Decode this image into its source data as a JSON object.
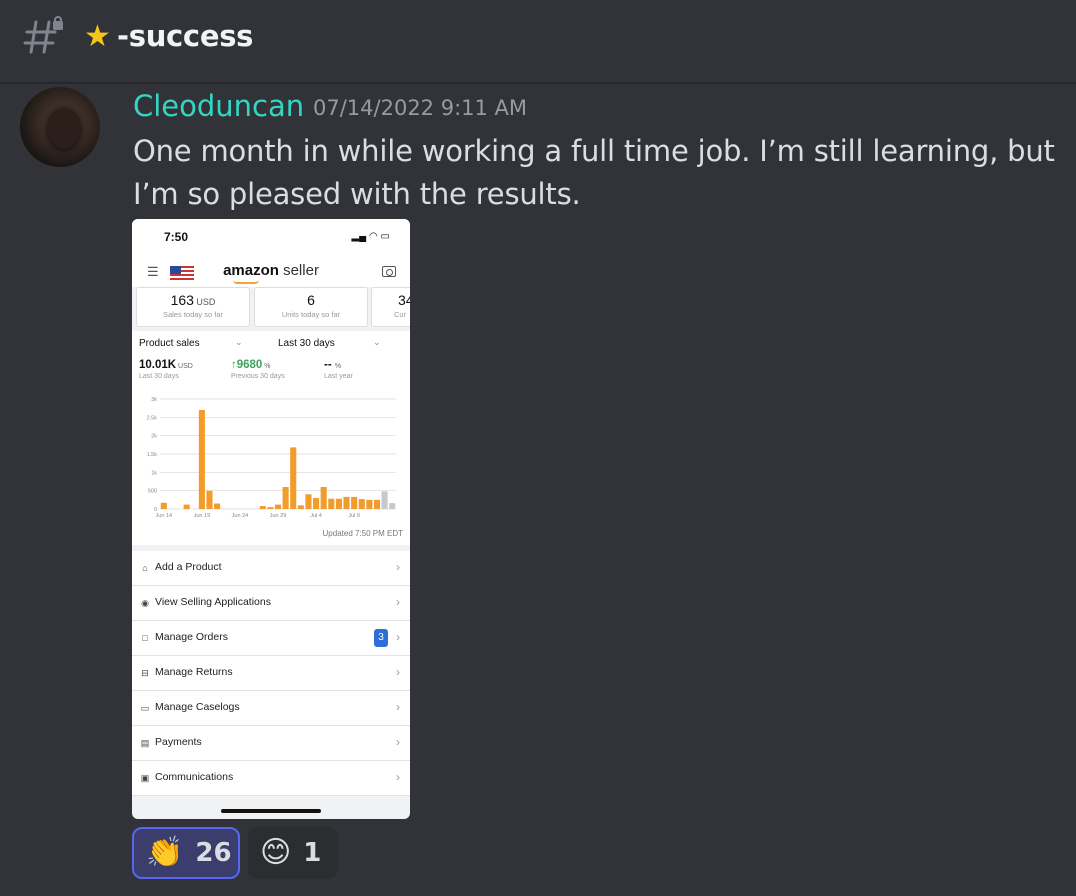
{
  "channel": {
    "name": "-success",
    "icons": [
      "hash-lock-icon",
      "star-emoji-icon"
    ]
  },
  "message": {
    "author": "Cleoduncan",
    "author_color": "#32d6c3",
    "timestamp": "07/14/2022 9:11 AM",
    "text": "One month in while working a full time job. I’m still learning, but I’m so pleased with the results."
  },
  "attachment": {
    "status_time": "7:50",
    "app_title_bold": "amazon",
    "app_title_rest": " seller",
    "kpis": [
      {
        "value": "163",
        "unit": " USD",
        "label": "Sales today so far"
      },
      {
        "value": "6",
        "unit": "",
        "label": "Units today so far"
      },
      {
        "value": "34",
        "unit": "",
        "label": "Cur"
      }
    ],
    "chart_controls": {
      "metric_select": "Product sales",
      "range_select": "Last 30 days"
    },
    "metrics": [
      {
        "value": "10.01K",
        "unit": " USD",
        "label": "Last 30 days"
      },
      {
        "value": "↑9680",
        "unit": " %",
        "label": "Previous 30 days"
      },
      {
        "value": "-- ",
        "unit": "%",
        "label": "Last year"
      }
    ],
    "updated": "Updated 7:50 PM EDT",
    "menu": [
      {
        "label": "Add a Product",
        "icon": "tag-icon"
      },
      {
        "label": "View Selling Applications",
        "icon": "eye-icon"
      },
      {
        "label": "Manage Orders",
        "icon": "box-icon",
        "badge": "3"
      },
      {
        "label": "Manage Returns",
        "icon": "return-icon"
      },
      {
        "label": "Manage Caselogs",
        "icon": "chat-icon"
      },
      {
        "label": "Payments",
        "icon": "card-icon"
      },
      {
        "label": "Communications",
        "icon": "messages-icon"
      }
    ]
  },
  "chart_data": {
    "type": "bar",
    "title": "",
    "xlabel": "",
    "ylabel": "",
    "ylim": [
      0,
      3000
    ],
    "yticks": [
      "0",
      "500",
      "1k",
      "1.5k",
      "2k",
      "2.5k",
      "3k"
    ],
    "xticks": [
      "Jun 14",
      "Jun 19",
      "Jun 24",
      "Jun 29",
      "Jul 4",
      "Jul 9"
    ],
    "values": [
      170,
      0,
      0,
      120,
      0,
      2700,
      500,
      150,
      0,
      0,
      0,
      0,
      0,
      80,
      50,
      120,
      600,
      1680,
      100,
      400,
      300,
      600,
      280,
      280,
      330,
      330,
      270,
      250,
      250,
      480,
      160
    ],
    "bar_colors": [
      "#f39c2b",
      "#f39c2b",
      "#f39c2b",
      "#f39c2b",
      "#f39c2b",
      "#f39c2b",
      "#f39c2b",
      "#f39c2b",
      "#f39c2b",
      "#f39c2b",
      "#f39c2b",
      "#f39c2b",
      "#f39c2b",
      "#f39c2b",
      "#f39c2b",
      "#f39c2b",
      "#f39c2b",
      "#f39c2b",
      "#f39c2b",
      "#f39c2b",
      "#f39c2b",
      "#f39c2b",
      "#f39c2b",
      "#f39c2b",
      "#f39c2b",
      "#f39c2b",
      "#f39c2b",
      "#f39c2b",
      "#f39c2b",
      "#c8c8c8",
      "#c8c8c8"
    ],
    "grid": true
  },
  "reactions": [
    {
      "emoji": "👏",
      "count": "26",
      "icon": "clapping-hands-icon",
      "selected": true
    },
    {
      "emoji": "😊",
      "count": "1",
      "icon": "smiling-face-icon",
      "selected": false
    }
  ]
}
